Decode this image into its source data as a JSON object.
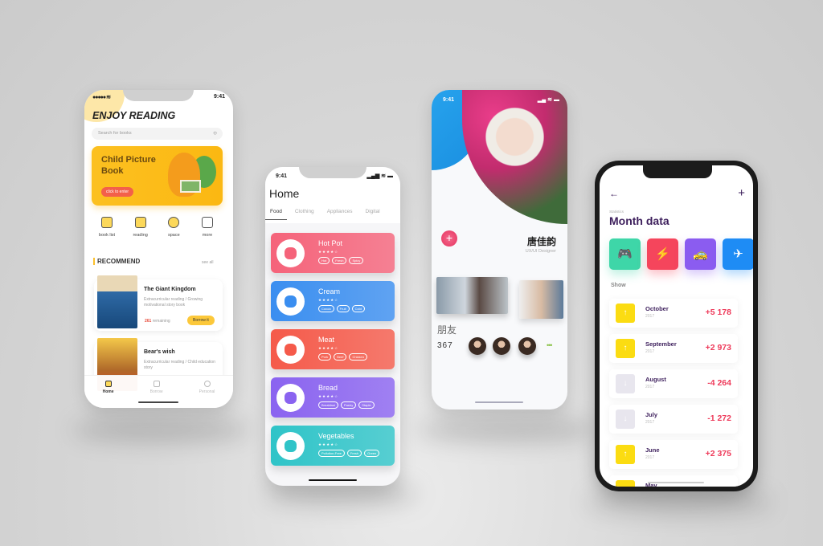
{
  "reading_app": {
    "status_time": "9:41",
    "title": "ENJOY READING",
    "search_placeholder": "Search for books",
    "banner": {
      "title": "Child Picture Book",
      "button": "click to enter"
    },
    "categories": [
      {
        "label": "book list",
        "icon": "book-icon"
      },
      {
        "label": "reading",
        "icon": "heart-book-icon"
      },
      {
        "label": "space",
        "icon": "planet-icon"
      },
      {
        "label": "more",
        "icon": "grid-icon"
      }
    ],
    "section_title": "RECOMMEND",
    "see_all": "see all",
    "books": [
      {
        "title": "The Giant Kingdom",
        "desc": "Extracurricular reading / Growing motivational story book",
        "remaining_count": "261",
        "remaining_label": "remaining",
        "button": "Borrow it"
      },
      {
        "title": "Bear's wish",
        "desc": "Extracurricular reading / Child education story"
      }
    ],
    "tabbar": [
      {
        "label": "Home",
        "active": true
      },
      {
        "label": "Borrow"
      },
      {
        "label": "Personal"
      }
    ]
  },
  "shop_app": {
    "status_time": "9:41",
    "title": "Home",
    "tabs": [
      "Food",
      "Clothing",
      "Appliances",
      "Digital"
    ],
    "active_tab": "Food",
    "cards": [
      {
        "name": "Hot Pot",
        "rating": 4,
        "stars": "★★★★☆",
        "tags": [
          "Hot",
          "Fresh",
          "Spicy"
        ],
        "color": "#f5637a",
        "icon": "hotpot-icon"
      },
      {
        "name": "Cream",
        "rating": 4,
        "stars": "★★★★☆",
        "tags": [
          "Cocoa",
          "Fruit",
          "Cold"
        ],
        "color": "#3a8ef0",
        "icon": "ice-cream-icon"
      },
      {
        "name": "Meat",
        "rating": 4,
        "stars": "★★★★☆",
        "tags": [
          "Pork",
          "Beef",
          "Chicken"
        ],
        "color": "#f55a4a",
        "icon": "steak-icon"
      },
      {
        "name": "Bread",
        "rating": 4,
        "stars": "★★★★☆",
        "tags": [
          "Breakfast",
          "Pastry",
          "Staple"
        ],
        "color": "#8a63f0",
        "icon": "bread-icon"
      },
      {
        "name": "Vegetables",
        "rating": 4,
        "stars": "★★★★☆",
        "tags": [
          "Pollution-Free",
          "Fresh",
          "Green"
        ],
        "color": "#2fc4c8",
        "icon": "broccoli-icon"
      }
    ]
  },
  "profile_app": {
    "status_time": "9:41",
    "name": "唐佳韵",
    "role": "UX/UI Designer",
    "add_label": "+",
    "friends_label": "朋友",
    "friends_count": "367",
    "more_label": "•••"
  },
  "stats_app": {
    "back_icon": "←",
    "add_icon": "+",
    "subtitle": "Statistics",
    "title": "Month data",
    "categories": [
      {
        "icon": "gamepad-icon",
        "glyph": "🎮",
        "color": "#3ed6a8"
      },
      {
        "icon": "fuel-drop-icon",
        "glyph": "⚡",
        "color": "#f5455c"
      },
      {
        "icon": "car-icon",
        "glyph": "🚕",
        "color": "#8b5cf0"
      },
      {
        "icon": "plane-icon",
        "glyph": "✈",
        "color": "#1e8cf5"
      }
    ],
    "show_label": "Show",
    "months": [
      {
        "month": "October",
        "year": "2017",
        "value": "+5 178",
        "trend": "up"
      },
      {
        "month": "September",
        "year": "2017",
        "value": "+2 973",
        "trend": "up"
      },
      {
        "month": "August",
        "year": "2017",
        "value": "-4 264",
        "trend": "down"
      },
      {
        "month": "July",
        "year": "2017",
        "value": "-1 272",
        "trend": "down"
      },
      {
        "month": "June",
        "year": "2017",
        "value": "+2 375",
        "trend": "up"
      },
      {
        "month": "May",
        "year": "",
        "value": "",
        "trend": "up"
      }
    ],
    "colors": {
      "up": "#fbdc12",
      "down": "#e8e6ee",
      "accent": "#ee3a5a",
      "title": "#3d1f5c"
    }
  }
}
